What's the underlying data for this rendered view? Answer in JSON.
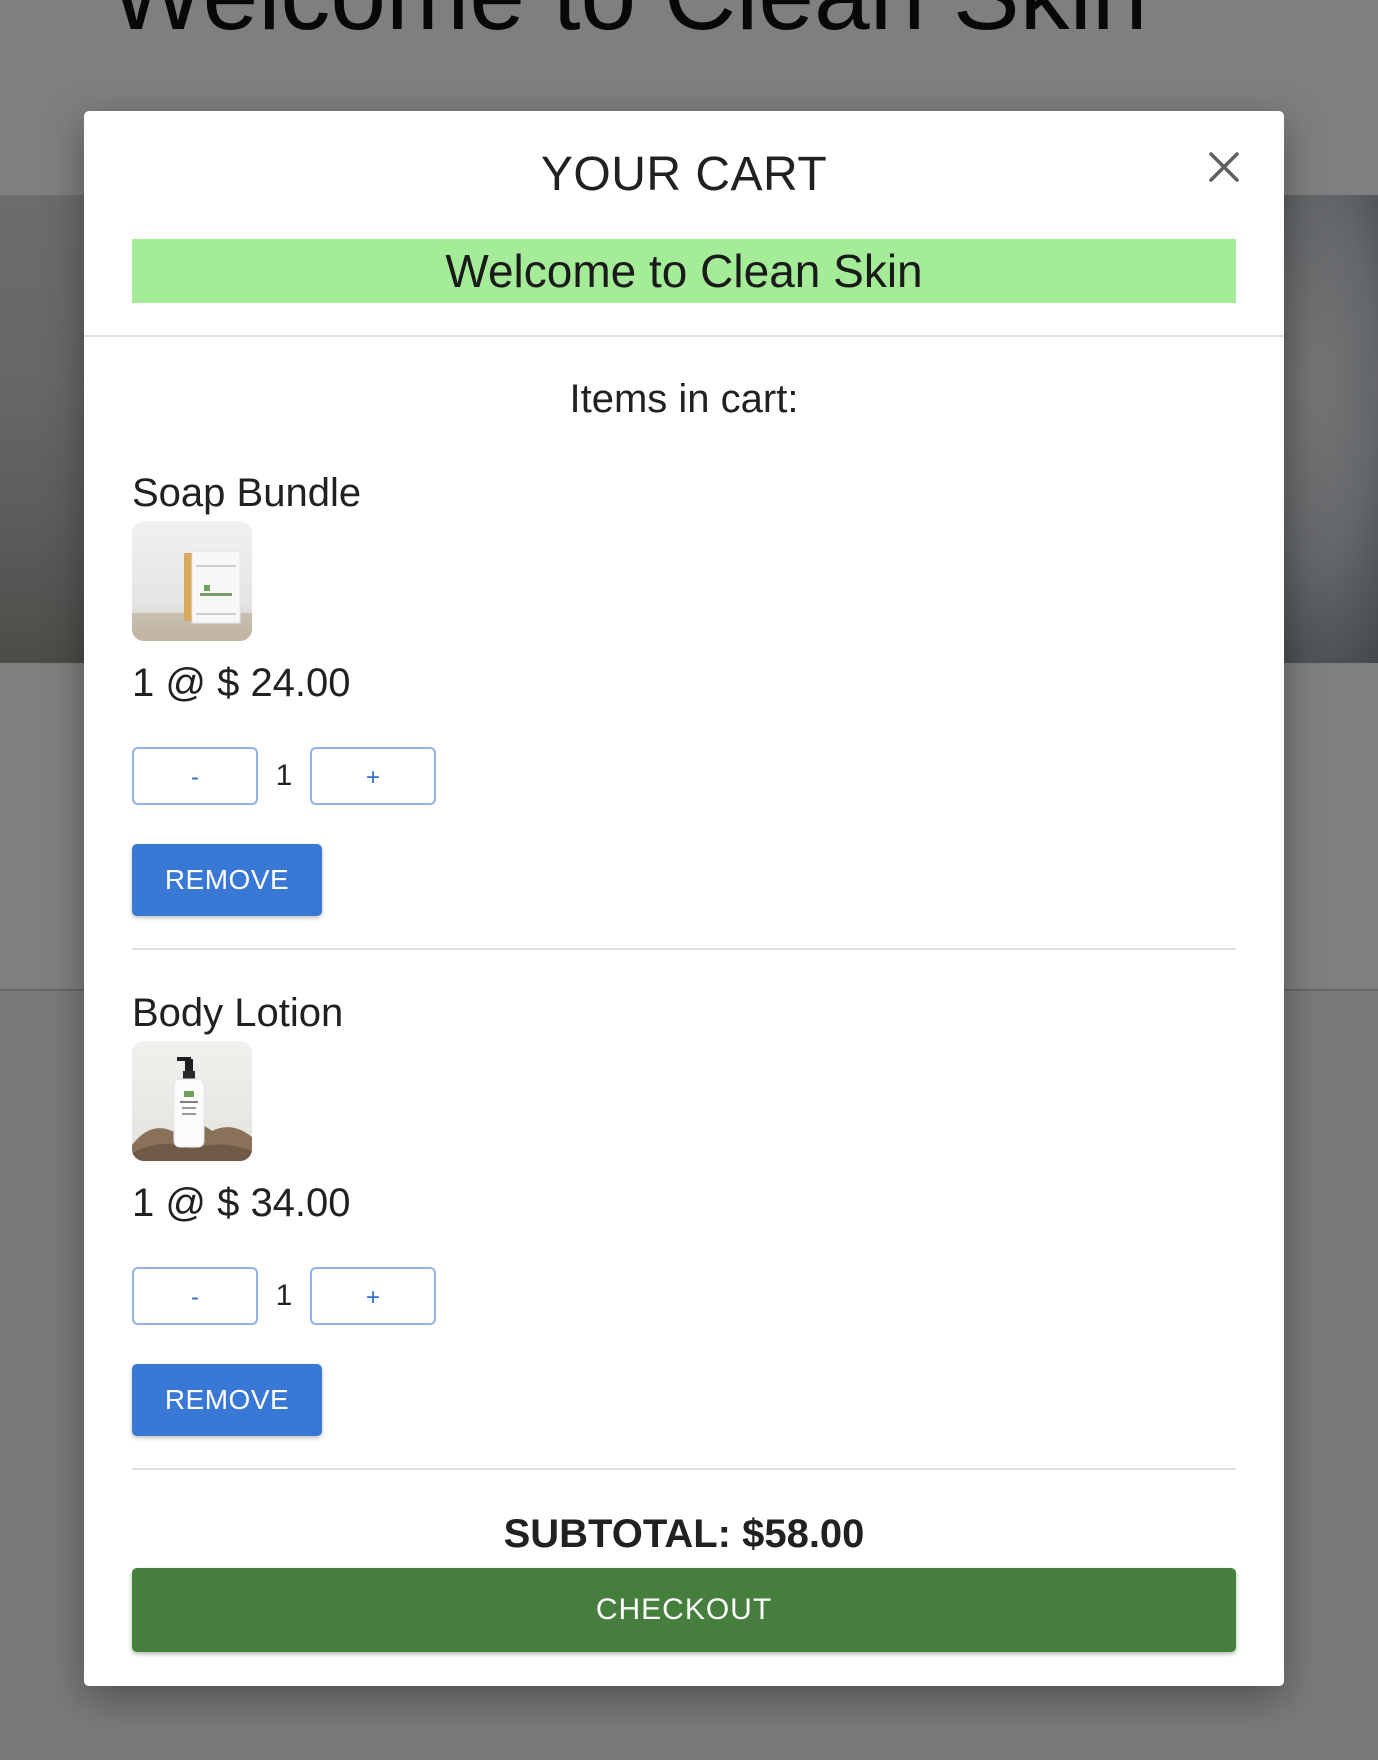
{
  "background": {
    "site_title": "Welcome to Clean Skin"
  },
  "modal": {
    "title": "YOUR CART",
    "close_icon": "close-icon",
    "banner": "Welcome to Clean Skin",
    "items_heading": "Items in cart:"
  },
  "cart": {
    "items": [
      {
        "name": "Soap Bundle",
        "image": "soap-bundle-thumbnail",
        "price_line": "1 @ $ 24.00",
        "minus_label": "-",
        "quantity": "1",
        "plus_label": "+",
        "remove_label": "REMOVE"
      },
      {
        "name": "Body Lotion",
        "image": "body-lotion-thumbnail",
        "price_line": "1 @ $ 34.00",
        "minus_label": "-",
        "quantity": "1",
        "plus_label": "+",
        "remove_label": "REMOVE"
      }
    ],
    "subtotal": "SUBTOTAL: $58.00",
    "checkout_label": "CHECKOUT"
  },
  "colors": {
    "banner": "#a4ec98",
    "remove_button": "#3a78d6",
    "checkout_button": "#467f3d",
    "qty_button_border": "#8fb2e8"
  }
}
